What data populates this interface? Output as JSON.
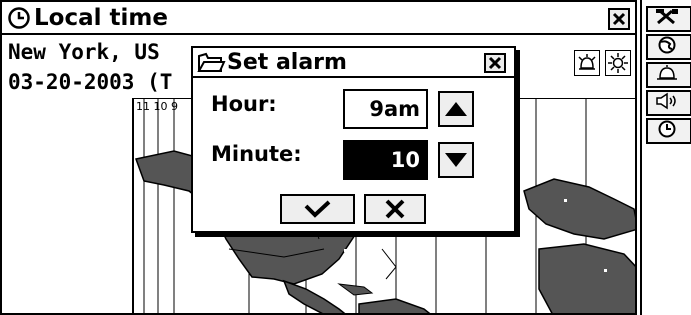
{
  "window": {
    "title": "Local time",
    "city_line": "New York, US",
    "date_line": "03-20-2003 (T",
    "timezone_labels": "11 10 9"
  },
  "dialog": {
    "title": "Set alarm",
    "hour_label": "Hour:",
    "hour_value": "9am",
    "minute_label": "Minute:",
    "minute_value": "10"
  },
  "icons": {
    "title": "clock-icon",
    "close": "close-icon",
    "dialog": "folder-icon",
    "ok": "checkmark-icon",
    "cancel": "x-icon",
    "up": "up-arrow-icon",
    "down": "down-arrow-icon",
    "toolbar": [
      "tools-icon",
      "globe-icon",
      "alarm-icon",
      "speaker-icon",
      "clock-icon"
    ]
  },
  "colors": {
    "foreground": "#000000",
    "background": "#ffffff",
    "land": "#555555"
  }
}
